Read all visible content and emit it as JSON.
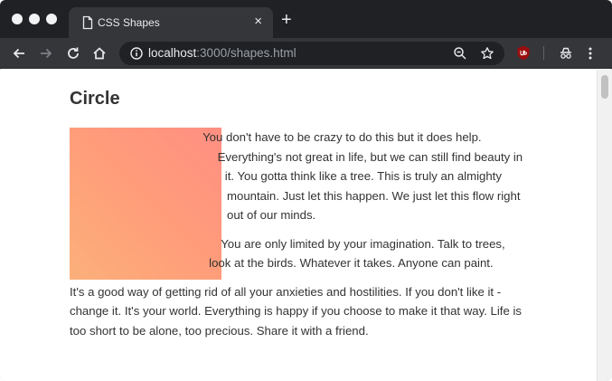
{
  "browser": {
    "tab_title": "CSS Shapes",
    "tab_close": "×",
    "new_tab": "+",
    "url_host": "localhost",
    "url_path": ":3000/shapes.html"
  },
  "page": {
    "heading": "Circle",
    "shape_gradient": [
      "#fcb07a",
      "#ff8f82"
    ],
    "paragraphs": [
      "You don't have to be crazy to do this but it does help. Everything's not great in life, but we can still find beauty in it. You gotta think like a tree. This is truly an almighty mountain. Just let this happen. We just let this flow right out of our minds.",
      "You are only limited by your imagination. Talk to trees, look at the birds. Whatever it takes. Anyone can paint.",
      "It's a good way of getting rid of all your anxieties and hostilities. If you don't like it - change it. It's your world. Everything is happy if you choose to make it that way. Life is too short to be alone, too precious. Share it with a friend."
    ]
  }
}
